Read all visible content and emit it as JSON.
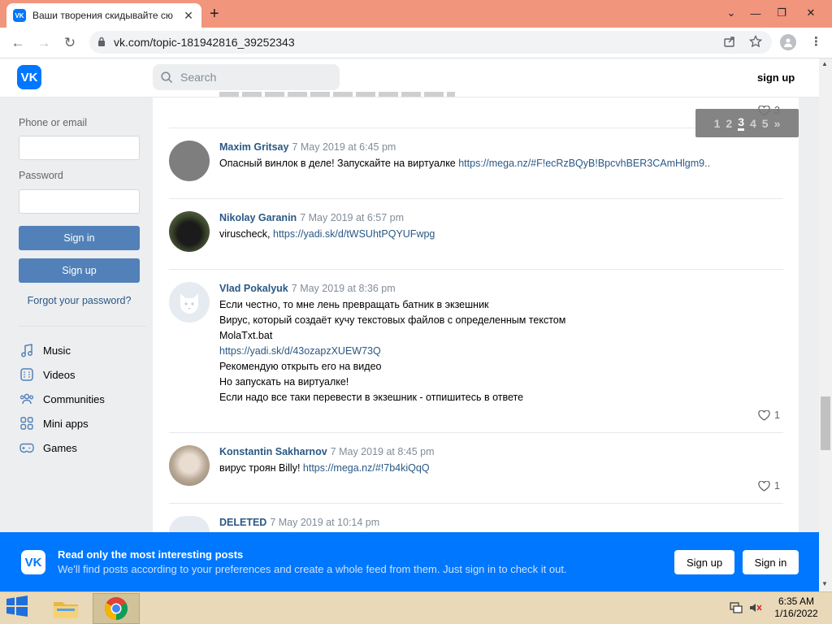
{
  "browser": {
    "tab_title": "Ваши творения скидывайте сю",
    "tab_close": "✕",
    "new_tab": "+",
    "url": "vk.com/topic-181942816_39252343",
    "nav_back": "←",
    "nav_forward": "→",
    "nav_reload": "↻",
    "win_min": "—",
    "win_max": "❐",
    "win_close": "✕",
    "win_menu": "⌄"
  },
  "vk_header": {
    "logo_text": "VK",
    "search_placeholder": "Search",
    "signup_label": "sign up"
  },
  "sidebar": {
    "phone_label": "Phone or email",
    "phone_value": "",
    "password_label": "Password",
    "password_value": "",
    "signin_label": "Sign in",
    "signup_label": "Sign up",
    "forgot_label": "Forgot your password?",
    "menu": [
      {
        "label": "Music",
        "icon": "music-icon"
      },
      {
        "label": "Videos",
        "icon": "videos-icon"
      },
      {
        "label": "Communities",
        "icon": "communities-icon"
      },
      {
        "label": "Mini apps",
        "icon": "mini-apps-icon"
      },
      {
        "label": "Games",
        "icon": "games-icon"
      }
    ]
  },
  "pagination": {
    "pages": [
      "1",
      "2",
      "3",
      "4",
      "5"
    ],
    "current": "3",
    "next": "»"
  },
  "prev_post_likes": "3",
  "posts": [
    {
      "author": "Maxim Gritsay",
      "date": "7 May 2019 at 6:45 pm",
      "lines": [
        {
          "text": "Опасный винлок в деле! Запускайте на виртуалке ",
          "link": "https://mega.nz/#F!ecRzBQyB!BpcvhBER3CAmHlgm9.."
        }
      ],
      "likes": ""
    },
    {
      "author": "Nikolay Garanin",
      "date": "7 May 2019 at 6:57 pm",
      "lines": [
        {
          "text": "viruscheck, ",
          "link": "https://yadi.sk/d/tWSUhtPQYUFwpg"
        }
      ],
      "likes": ""
    },
    {
      "author": "Vlad Pokalyuk",
      "date": "7 May 2019 at 8:36 pm",
      "lines": [
        {
          "text": "Если честно, то мне лень превращать батник в экзешник",
          "link": ""
        },
        {
          "text": "Вирус, который создаёт кучу текстовых файлов с определенным текстом",
          "link": ""
        },
        {
          "text": "MolaTxt.bat",
          "link": ""
        },
        {
          "text": "",
          "link": "https://yadi.sk/d/43ozapzXUEW73Q"
        },
        {
          "text": "Рекомендую открыть его на видео",
          "link": ""
        },
        {
          "text": "Но запускать на виртуалке!",
          "link": ""
        },
        {
          "text": "Если надо все таки перевести в экзешник - отпишитесь в ответе",
          "link": ""
        }
      ],
      "likes": "1"
    },
    {
      "author": "Konstantin Sakharnov",
      "date": "7 May 2019 at 8:45 pm",
      "lines": [
        {
          "text": "вирус троян Billy! ",
          "link": "https://mega.nz/#!7b4kiQqQ"
        }
      ],
      "likes": "1"
    },
    {
      "author": "DELETED",
      "date": "7 May 2019 at 10:14 pm",
      "lines": [],
      "likes": ""
    }
  ],
  "banner": {
    "title": "Read only the most interesting posts",
    "subtitle": "We'll find posts according to your preferences and create a whole feed from them. Just sign in to check it out.",
    "signup_label": "Sign up",
    "signin_label": "Sign in"
  },
  "taskbar": {
    "time": "6:35 AM",
    "date": "1/16/2022"
  },
  "colors": {
    "vk_blue": "#0077ff",
    "link": "#2a5885",
    "button": "#5181b8",
    "tab_bar": "#f1957d",
    "taskbar": "#e9d9b9"
  }
}
